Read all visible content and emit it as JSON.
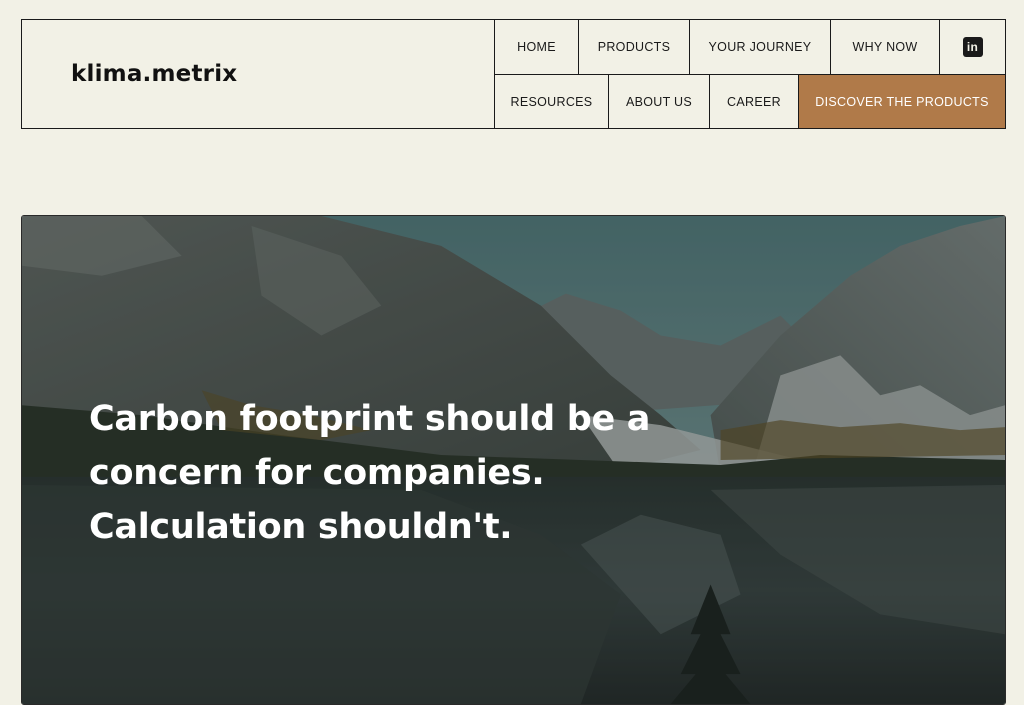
{
  "brand": {
    "logo_text": "klima.metrix"
  },
  "nav": {
    "row1": [
      {
        "label": "HOME"
      },
      {
        "label": "PRODUCTS"
      },
      {
        "label": "YOUR JOURNEY"
      },
      {
        "label": "WHY NOW"
      }
    ],
    "linkedin_icon": "linkedin-icon",
    "linkedin_glyph": "in",
    "row2": [
      {
        "label": "RESOURCES"
      },
      {
        "label": "ABOUT US"
      },
      {
        "label": "CAREER"
      }
    ],
    "cta_label": "DISCOVER THE PRODUCTS",
    "cta_color": "#b07a49"
  },
  "hero": {
    "line1": "Carbon footprint should be a",
    "line2": "concern for companies.",
    "line3": "Calculation shouldn't."
  },
  "colors": {
    "page_bg": "#f2f1e6",
    "border": "#1a1a1a",
    "accent": "#b07a49"
  }
}
